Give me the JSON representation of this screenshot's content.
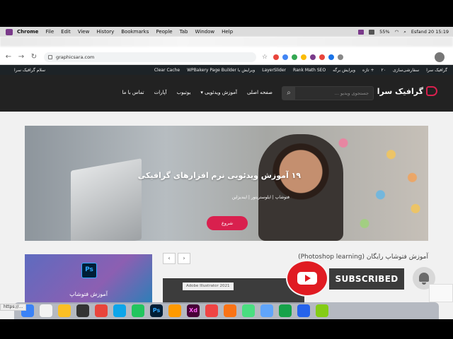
{
  "menubar": {
    "app": "Chrome",
    "items": [
      "File",
      "Edit",
      "View",
      "History",
      "Bookmarks",
      "People",
      "Tab",
      "Window",
      "Help"
    ],
    "battery": "55%",
    "clock": "Esfand 20  15:19"
  },
  "browser": {
    "url": "graphicsara.com"
  },
  "wpadmin": {
    "items": [
      "گرافیک سرا",
      "سفارشی‌سازی",
      "۲۰",
      "+ تازه",
      "ویرایش برگه",
      "Rank Math SEO",
      "LayerSlider",
      "ویرایش با WPBakery Page Builder",
      "Clear Cache"
    ],
    "greeting": "سلام گرافیک سرا"
  },
  "header": {
    "logo": "گرافیک سرا",
    "search_placeholder": "جستجوی ویدیو ...",
    "nav": [
      "صفحه اصلی",
      "آموزش ویدئویی ▾",
      "یوتیوب",
      "آپارات",
      "تماس با ما"
    ]
  },
  "hero": {
    "title": "۱۹ آموزش ویدئویی نرم افزارهای گرافیکی",
    "categories": "فتوشاپ  |  ایلوستریتور  |  ایندیزاین",
    "button": "شروع"
  },
  "section": {
    "title": "آموزش فتوشاپ رایگان (Photoshop learning)",
    "prev": "‹",
    "next": "›"
  },
  "cards": {
    "ps_icon": "Ps",
    "ps_label": "آموزش فتوشاپ",
    "ai_tag": "Adobe Illustrator 2021"
  },
  "overlay": {
    "subscribed": "SUBSCRIBED"
  },
  "status_bar": "https://..."
}
